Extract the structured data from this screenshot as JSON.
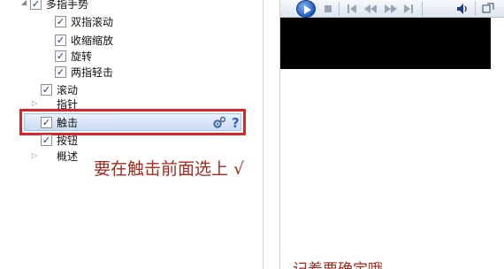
{
  "tree": {
    "items": [
      {
        "label": "多指手势",
        "checked": true,
        "level": 0
      },
      {
        "label": "双指滚动",
        "checked": true,
        "level": 1
      },
      {
        "label": "收缩缩放",
        "checked": true,
        "level": 1
      },
      {
        "label": "旋转",
        "checked": true,
        "level": 1
      },
      {
        "label": "两指轻击",
        "checked": true,
        "level": 1
      },
      {
        "label": "滚动",
        "checked": true,
        "level": 0
      },
      {
        "label": "指针",
        "checked": false,
        "level": 0
      },
      {
        "label": "触击",
        "checked": true,
        "level": 0
      },
      {
        "label": "按钮",
        "checked": true,
        "level": 0
      },
      {
        "label": "概述",
        "checked": false,
        "level": 0
      }
    ],
    "check_mark": "✓",
    "expander_glyph": "▷",
    "expanded_glyph": "◢",
    "help_glyph": "?"
  },
  "annotations": {
    "main": "要在触击前面选上 √",
    "bottom": "记着要确定哦"
  },
  "colors": {
    "highlight_border": "#d6262b",
    "annotation_text": "#a52a1e"
  }
}
